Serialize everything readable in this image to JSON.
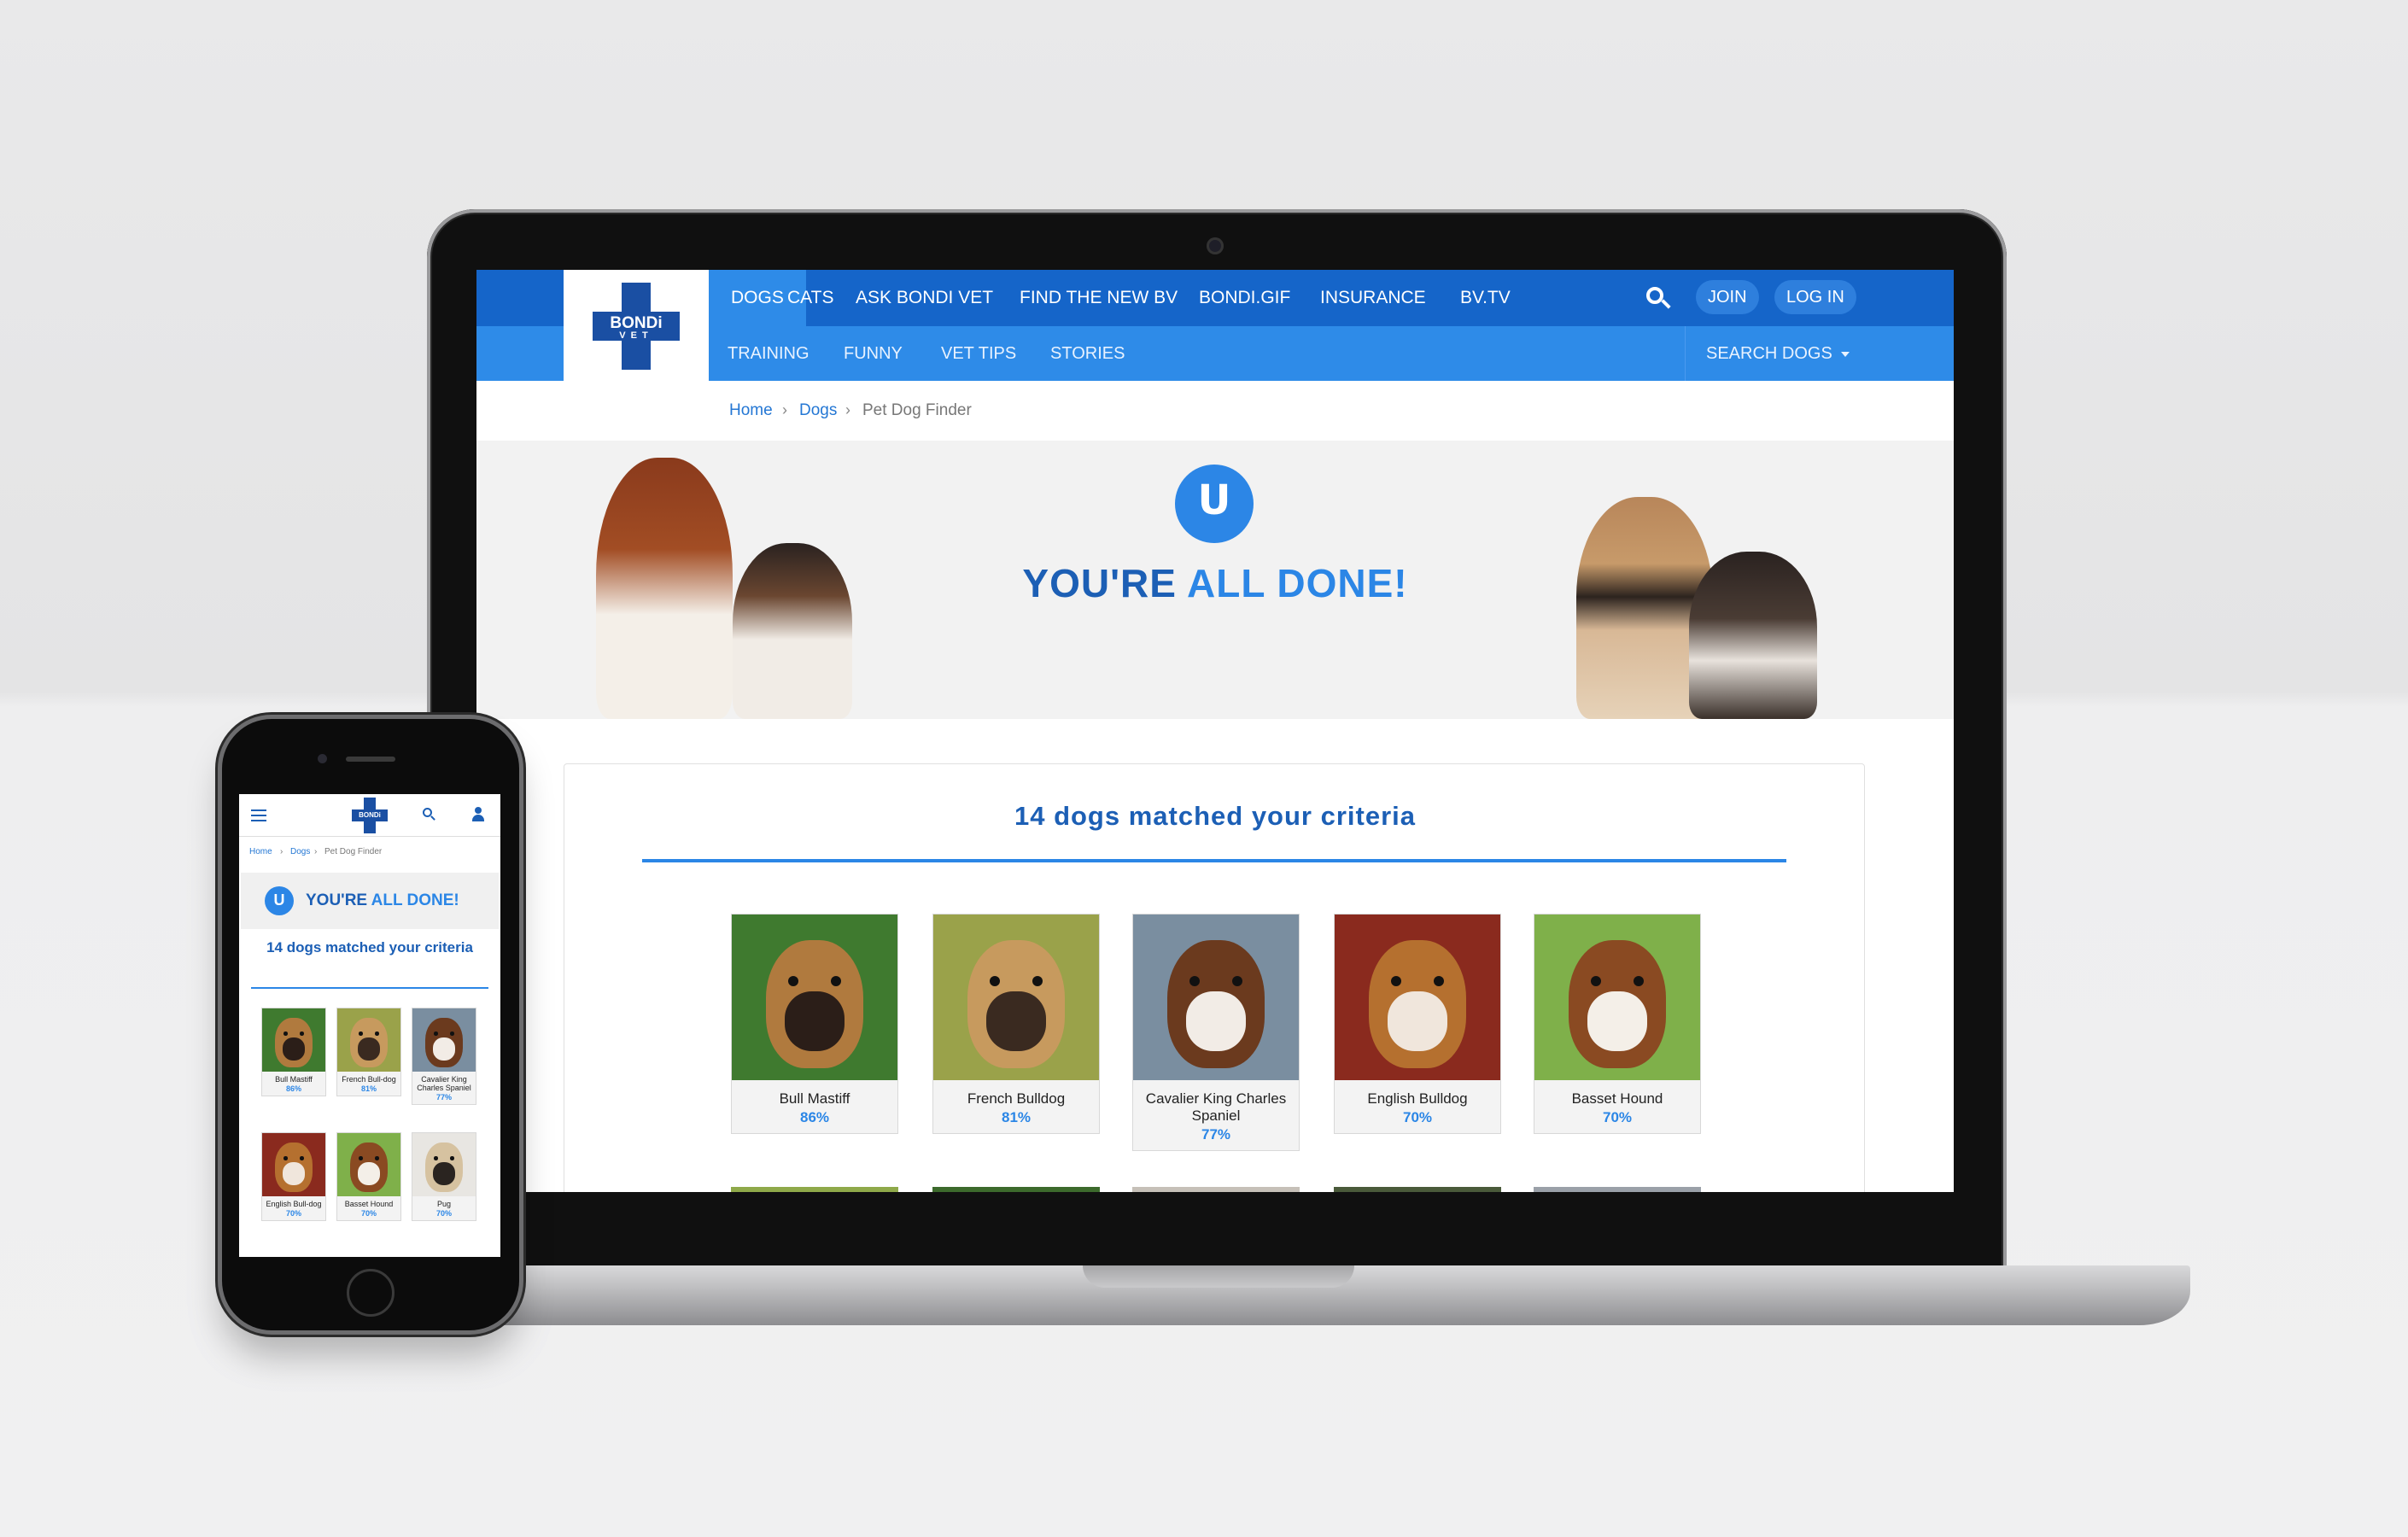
{
  "nav": {
    "logo_text": "BONDi",
    "logo_sub": "VET",
    "primary": [
      "DOGS",
      "CATS",
      "ASK BONDI VET",
      "FIND THE NEW BV",
      "BONDI.GIF",
      "INSURANCE",
      "BV.TV"
    ],
    "active": "DOGS",
    "join": "JOIN",
    "login": "LOG IN",
    "secondary": [
      "TRAINING",
      "FUNNY",
      "VET TIPS",
      "STORIES"
    ],
    "search_dogs": "SEARCH DOGS"
  },
  "breadcrumb": {
    "home": "Home",
    "dogs": "Dogs",
    "current": "Pet Dog Finder",
    "sep": "›"
  },
  "hero": {
    "badge": "U",
    "title_a": "YOU'RE ",
    "title_b": "ALL DONE!"
  },
  "results": {
    "title": "14 dogs matched your criteria",
    "dogs": [
      {
        "name": "Bull Mastiff",
        "pct": "86%",
        "bg": "#3f7a2f",
        "fur": "#b07a3e",
        "face": "#2b1e18"
      },
      {
        "name": "French Bulldog",
        "pct": "81%",
        "bg": "#9aa24a",
        "fur": "#c79a5e",
        "face": "#3a2a20"
      },
      {
        "name": "Cavalier King Charles Spaniel",
        "pct": "77%",
        "bg": "#7a8ea0",
        "fur": "#6b3a1e",
        "face": "#f2ece6"
      },
      {
        "name": "English Bulldog",
        "pct": "70%",
        "bg": "#8a2a1e",
        "fur": "#b5702f",
        "face": "#f0e6dc"
      },
      {
        "name": "Basset Hound",
        "pct": "70%",
        "bg": "#7fb04a",
        "fur": "#8a4a22",
        "face": "#f4efe8"
      }
    ]
  },
  "mobile": {
    "breadcrumb": {
      "home": "Home",
      "dogs": "Dogs",
      "current": "Pet Dog Finder"
    },
    "title_a": "YOU'RE ",
    "title_b": "ALL DONE!",
    "subtitle": "14 dogs matched your criteria",
    "dogs": [
      {
        "name": "Bull Mastiff",
        "pct": "86%"
      },
      {
        "name": "French Bull-dog",
        "pct": "81%"
      },
      {
        "name": "Cavalier King Charles Spaniel",
        "pct": "77%"
      },
      {
        "name": "English Bull-dog",
        "pct": "70%"
      },
      {
        "name": "Basset Hound",
        "pct": "70%"
      },
      {
        "name": "Pug",
        "pct": "70%"
      }
    ]
  },
  "colors": {
    "brand_dark": "#1565c9",
    "brand_light": "#2e8be8",
    "accent": "#2b86e6",
    "title": "#1c5fb5"
  }
}
